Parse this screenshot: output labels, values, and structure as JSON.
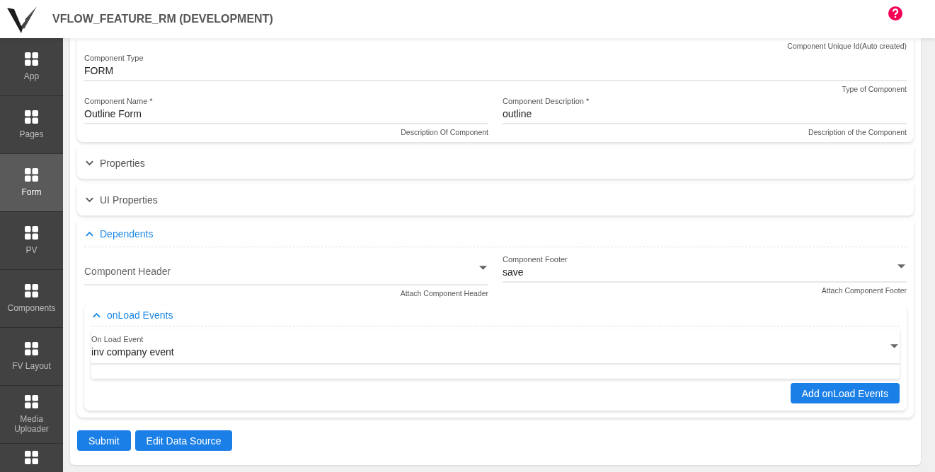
{
  "header": {
    "title": "VFLOW_FEATURE_RM (DEVELOPMENT)"
  },
  "sidebar": {
    "items": [
      {
        "label": "App",
        "selected": false
      },
      {
        "label": "Pages",
        "selected": false
      },
      {
        "label": "Form",
        "selected": true
      },
      {
        "label": "PV",
        "selected": false
      },
      {
        "label": "Components",
        "selected": false
      },
      {
        "label": "FV Layout",
        "selected": false
      },
      {
        "label": "Media Uploader",
        "selected": false
      }
    ]
  },
  "basic_card": {
    "top_helper": "Component Unique Id(Auto created)",
    "rows": [
      [
        {
          "label": "Component Type",
          "value": "FORM",
          "helper": "Type of Component"
        }
      ],
      [
        {
          "label": "Component Name *",
          "value": "Outline Form",
          "helper": "Description Of Component"
        },
        {
          "label": "Component Description *",
          "value": "outline",
          "helper": "Description of the Component"
        }
      ]
    ]
  },
  "sections": [
    {
      "title": "Properties",
      "expanded": false
    },
    {
      "title": "UI Properties",
      "expanded": false
    },
    {
      "title": "Dependents",
      "expanded": true,
      "fields": [
        {
          "kind": "select",
          "placeholder": "Component Header",
          "helper": "Attach Component Header"
        },
        {
          "kind": "select",
          "label": "Component Footer",
          "value": "save",
          "helper": "Attach Component Footer"
        }
      ],
      "subsection": {
        "title": "onLoad Events",
        "expanded": true,
        "field": {
          "kind": "select",
          "label": "On Load Event",
          "value": "inv company event"
        },
        "add_button": "Add onLoad Events"
      }
    }
  ],
  "buttons": [
    "Submit",
    "Edit Data Source"
  ]
}
